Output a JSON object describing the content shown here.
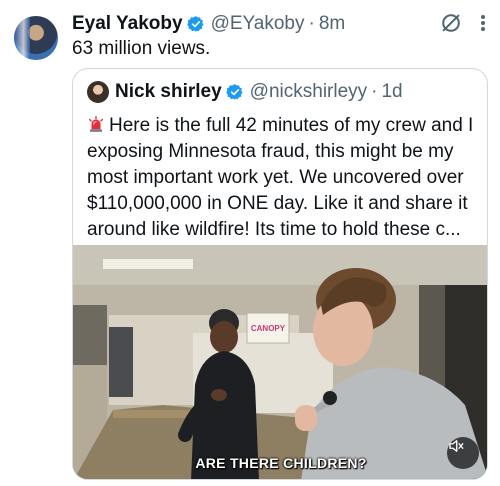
{
  "post": {
    "author_name": "Eyal Yakoby",
    "handle": "@EYakoby",
    "separator": "·",
    "time": "8m",
    "text": "63 million views."
  },
  "quoted": {
    "author_name": "Nick shirley",
    "handle": "@nickshirleyy",
    "separator": "·",
    "time": "1d",
    "body": "Here is the full 42 minutes of my crew and I exposing Minnesota fraud, this might be my most important work yet. We uncovered over $110,000,000 in ONE day. Like it and share it around like wildfire! Its time to hold these c...",
    "body_emoji": "rotating-light-icon",
    "video": {
      "caption": "ARE THERE CHILDREN?",
      "sign_text": "CANOPY",
      "muted": true
    }
  },
  "colors": {
    "text": "#0f1419",
    "secondary": "#536471",
    "verified": "#1d9bf0",
    "border": "#cfd9de"
  },
  "icons": [
    "verified-badge-icon",
    "grok-icon",
    "more-icon",
    "rotating-light-icon",
    "mute-icon"
  ]
}
